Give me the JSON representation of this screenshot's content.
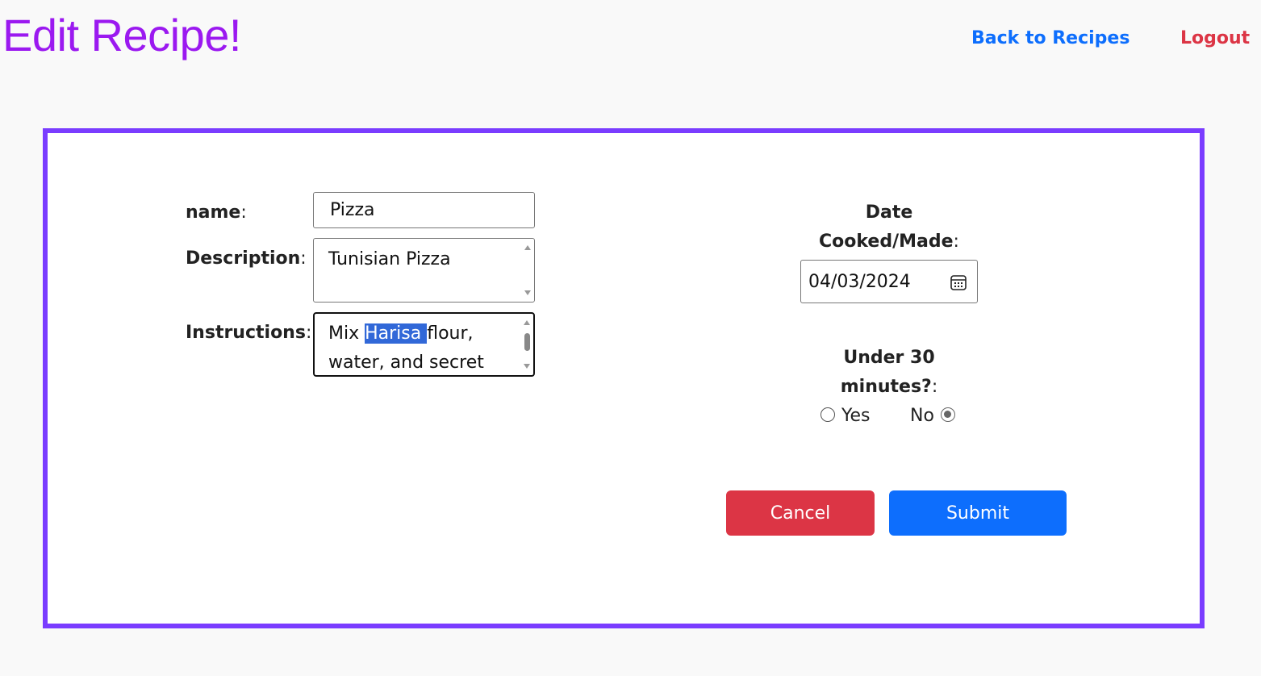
{
  "header": {
    "title": "Edit Recipe!",
    "back_link": "Back to Recipes",
    "logout_link": "Logout"
  },
  "form": {
    "name": {
      "label": "name",
      "value": "Pizza"
    },
    "description": {
      "label": "Description",
      "value": "Tunisian Pizza"
    },
    "instructions": {
      "label": "Instructions",
      "line1_before": "Mix ",
      "line1_selected": "Harisa ",
      "line1_after": "flour,",
      "line2": "water, and secret"
    },
    "date": {
      "label_line1": "Date",
      "label_line2": "Cooked/Made",
      "value": "04/03/2024"
    },
    "under30": {
      "label_line1": "Under 30",
      "label_line2": "minutes?",
      "options": [
        {
          "label": "Yes",
          "checked": false
        },
        {
          "label": "No",
          "checked": true
        }
      ]
    },
    "cancel_label": "Cancel",
    "submit_label": "Submit"
  },
  "colors": {
    "title": "#9b19f0",
    "back_link": "#0d6efd",
    "logout_link": "#dc3545",
    "card_border": "#7a3cff",
    "cancel_button": "#dc3545",
    "submit_button": "#0d6efd",
    "selection": "#3168d8"
  },
  "icons": {
    "date_picker": "calendar-icon"
  }
}
